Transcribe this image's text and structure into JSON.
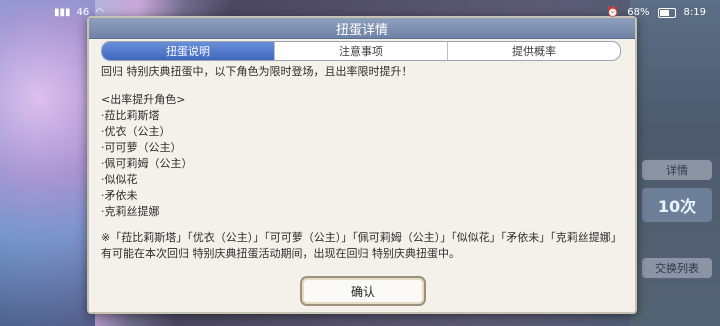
{
  "status_bar": {
    "net_label": "46",
    "battery_percent": "68%",
    "time": "8:19"
  },
  "background": {
    "detail_label": "详情",
    "count_label": "10次",
    "exchange_label": "交换列表"
  },
  "dialog": {
    "title": "扭蛋详情",
    "tabs": [
      {
        "label": "扭蛋说明",
        "active": true
      },
      {
        "label": "注意事项",
        "active": false
      },
      {
        "label": "提供概率",
        "active": false
      }
    ],
    "intro": "回归 特别庆典扭蛋中，以下角色为限时登场，且出率限时提升！",
    "section_title": "<出率提升角色>",
    "characters": [
      "·菈比莉斯塔",
      "·优衣（公主）",
      "·可可萝（公主）",
      "·佩可莉姆（公主）",
      "·似似花",
      "·矛依未",
      "·克莉丝提娜"
    ],
    "note_line1": "※「菈比莉斯塔」「优衣（公主）」「可可萝（公主）」「佩可莉姆（公主）」「似似花」「矛依未」「克莉丝提娜」",
    "note_line2": "有可能在本次回归 特别庆典扭蛋活动期间，出现在回归 特别庆典扭蛋中。",
    "confirm_label": "确认"
  }
}
